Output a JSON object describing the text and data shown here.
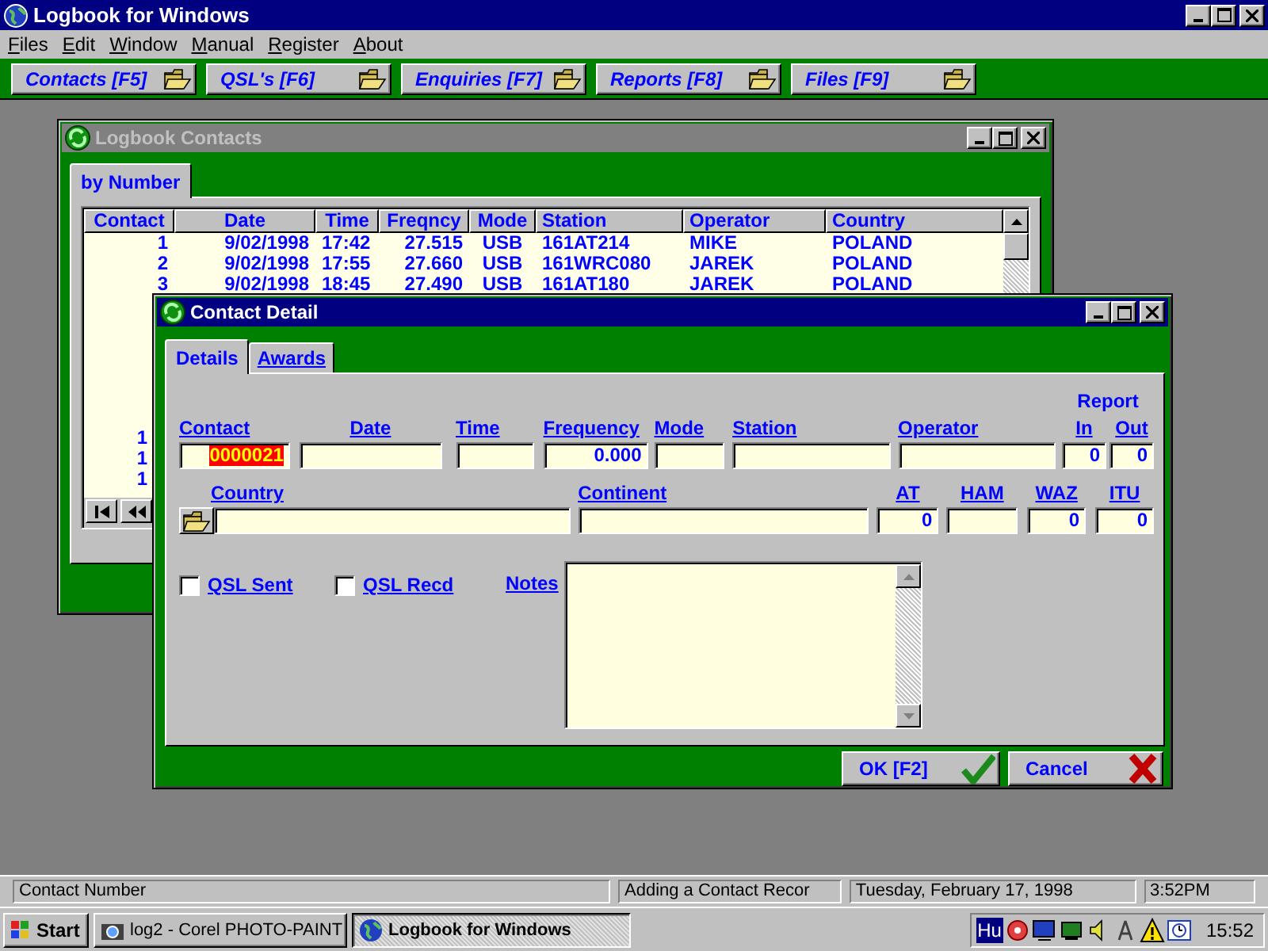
{
  "app": {
    "title": "Logbook for Windows"
  },
  "menu": [
    {
      "label": "Files"
    },
    {
      "label": "Edit"
    },
    {
      "label": "Window"
    },
    {
      "label": "Manual"
    },
    {
      "label": "Register"
    },
    {
      "label": "About"
    }
  ],
  "toolbar": [
    {
      "label": "Contacts [F5]"
    },
    {
      "label": "QSL's [F6]"
    },
    {
      "label": "Enquiries [F7]"
    },
    {
      "label": "Reports [F8]"
    },
    {
      "label": "Files [F9]"
    }
  ],
  "contacts_window": {
    "title": "Logbook Contacts",
    "active": false,
    "tabs": [
      {
        "label": "by Number",
        "selected": true
      }
    ],
    "columns": [
      "Contact",
      "Date",
      "Time",
      "Freqncy",
      "Mode",
      "Station",
      "Operator",
      "Country"
    ],
    "rows": [
      [
        "1",
        "9/02/1998",
        "17:42",
        "27.515",
        "USB",
        "161AT214",
        "MIKE",
        "POLAND"
      ],
      [
        "2",
        "9/02/1998",
        "17:55",
        "27.660",
        "USB",
        "161WRC080",
        "JAREK",
        "POLAND"
      ],
      [
        "3",
        "9/02/1998",
        "18:45",
        "27.490",
        "USB",
        "161AT180",
        "JAREK",
        "POLAND"
      ]
    ],
    "lower_rows": [
      {
        "contact": "1"
      },
      {
        "contact": "1"
      },
      {
        "contact": "1"
      }
    ]
  },
  "detail_window": {
    "title": "Contact Detail",
    "active": true,
    "tabs": [
      {
        "label": "Details",
        "selected": true
      },
      {
        "label": "Awards",
        "selected": false
      }
    ],
    "fields": [
      {
        "label": "Contact",
        "value": "0000021",
        "selected": true
      },
      {
        "label": "Date"
      },
      {
        "label": "Time"
      },
      {
        "label": "Frequency",
        "value": "0.000"
      },
      {
        "label": "Mode"
      },
      {
        "label": "Station"
      },
      {
        "label": "Operator"
      }
    ],
    "report": {
      "label": "Report",
      "fields": [
        {
          "label": "In",
          "value": "0"
        },
        {
          "label": "Out",
          "value": "0"
        }
      ]
    },
    "fields_row2": [
      {
        "label": "Country"
      },
      {
        "label": "Continent"
      },
      {
        "label": "AT",
        "value": "0"
      },
      {
        "label": "HAM"
      },
      {
        "label": "WAZ",
        "value": "0"
      },
      {
        "label": "ITU",
        "value": "0"
      }
    ],
    "checkboxes": [
      {
        "label": "QSL Sent",
        "checked": false
      },
      {
        "label": "QSL Recd",
        "checked": false
      }
    ],
    "notes": {
      "label": "Notes"
    },
    "buttons": [
      {
        "label": "OK [F2]",
        "kind": "ok"
      },
      {
        "label": "Cancel",
        "kind": "cancel"
      }
    ]
  },
  "status_bar": [
    "Contact Number",
    "Adding a Contact Recor",
    "Tuesday, February 17, 1998",
    "3:52PM"
  ],
  "taskbar": {
    "start": "Start",
    "tasks": [
      {
        "label": "log2 - Corel PHOTO-PAINT",
        "selected": false
      },
      {
        "label": "Logbook for Windows",
        "selected": true
      }
    ],
    "tray_badge": "Hu",
    "clock": "15:52"
  }
}
